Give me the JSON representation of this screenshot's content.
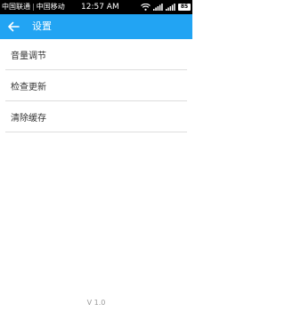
{
  "status_bar": {
    "carrier1": "中国联通",
    "carrier2": "中国移动",
    "time": "12:57 AM",
    "battery_level": "85"
  },
  "app_bar": {
    "back_icon": "arrow-left-icon",
    "title": "设置"
  },
  "menu": {
    "items": [
      {
        "label": "音量调节"
      },
      {
        "label": "检查更新"
      },
      {
        "label": "清除缓存"
      }
    ]
  },
  "footer": {
    "version": "V 1.0"
  },
  "colors": {
    "app_bar": "#22a4f3",
    "status_bar": "#000000",
    "divider": "#dddddd",
    "version_text": "#9a9a9a"
  }
}
